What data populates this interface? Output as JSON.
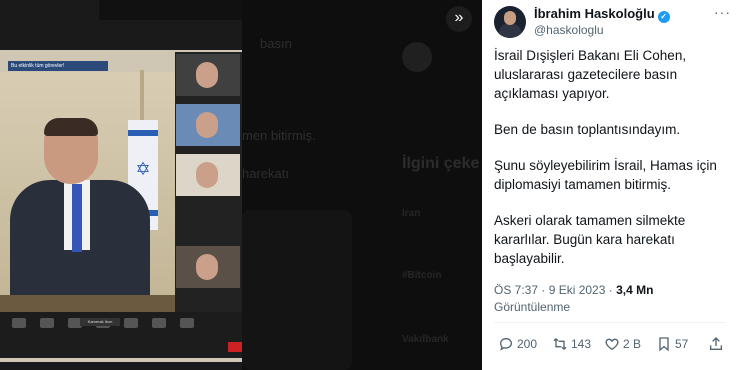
{
  "photo": {
    "zoom_topbar_text": "Bu etkinlik tüm görevler!",
    "name_tag": "Kameralı İkon"
  },
  "background_page": {
    "fragments": [
      "basın",
      "men bitirmiş.",
      "harekatı"
    ],
    "sidebar_title": "İlgini çeke",
    "trends": [
      {
        "topic": "Iran"
      },
      {
        "topic": "#Bitcoin"
      },
      {
        "topic": "Vakıfbank"
      }
    ]
  },
  "tweet": {
    "author_name": "İbrahim Haskoloğlu",
    "handle": "@haskologlu",
    "paragraphs": [
      "İsrail Dışişleri Bakanı Eli Cohen, uluslararası gazetecilere basın açıklaması yapıyor.",
      "Ben de basın toplantısındayım.",
      "Şunu söyleyebilirim İsrail, Hamas için diplomasiyi tamamen bitirmiş.",
      "Askeri olarak tamamen silmekte kararlılar. Bugün kara harekatı başlayabilir."
    ],
    "timestamp": "ÖS 7:37 · 9 Eki 2023 · ",
    "views_count": "3,4 Mn",
    "views_label": "Görüntülenme",
    "replies": "200",
    "retweets": "143",
    "likes": "2 B",
    "bookmarks": "57",
    "accent_color": "#1d9bf0"
  }
}
